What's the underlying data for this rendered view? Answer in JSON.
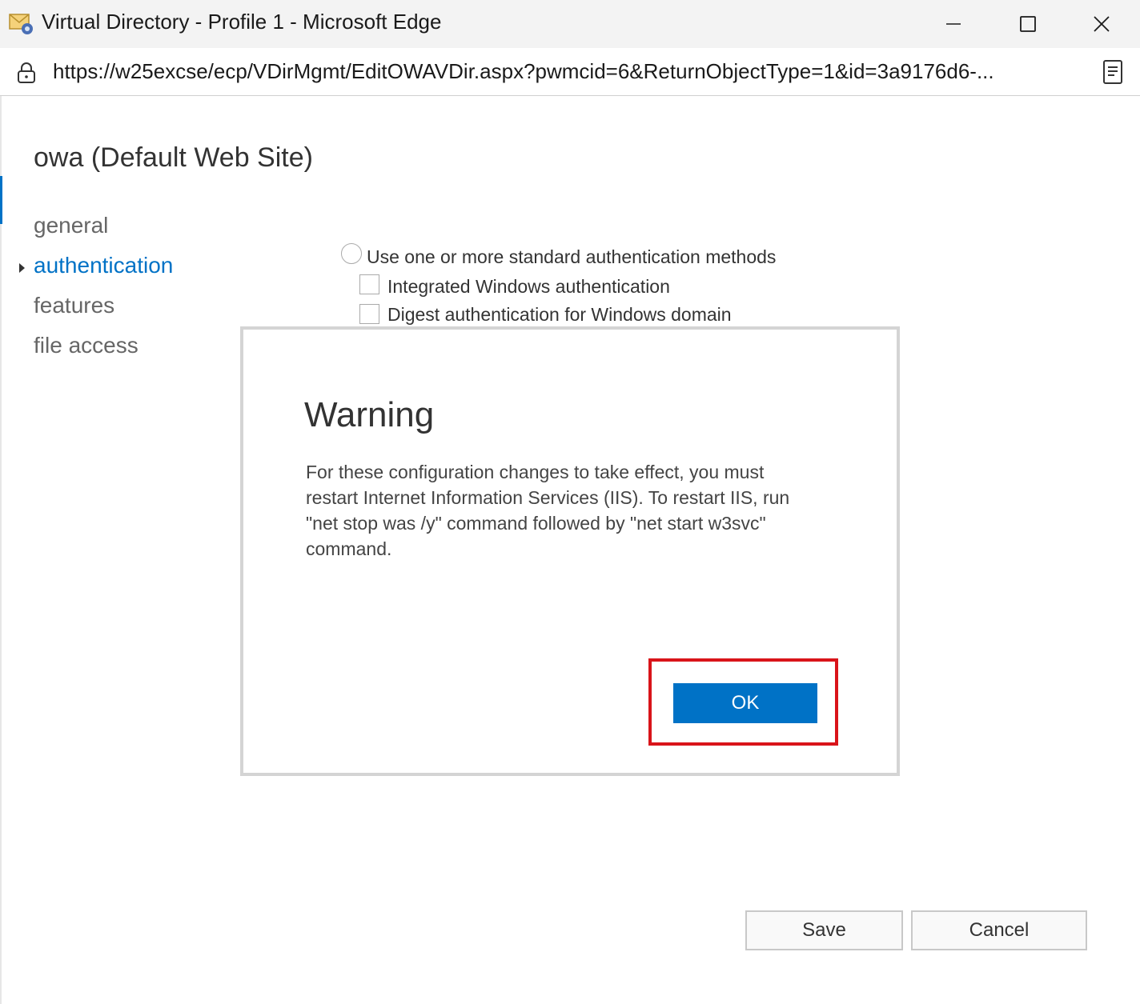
{
  "window": {
    "title": "Virtual Directory - Profile 1 - Microsoft Edge",
    "app_icon": "exchange-mail-icon",
    "controls": [
      "minimize-icon",
      "maximize-icon",
      "close-icon"
    ]
  },
  "addressbar": {
    "url": "https://w25excse/ecp/VDirMgmt/EditOWAVDir.aspx?pwmcid=6&ReturnObjectType=1&id=3a9176d6-...",
    "lock_icon": "lock-icon",
    "reader_icon": "reader-mode-icon"
  },
  "page": {
    "title": "owa (Default Web Site)",
    "nav": [
      {
        "label": "general",
        "active": false
      },
      {
        "label": "authentication",
        "active": true
      },
      {
        "label": "features",
        "active": false
      },
      {
        "label": "file access",
        "active": false
      }
    ],
    "auth": {
      "radio_label": "Use one or more standard authentication methods",
      "options": [
        {
          "label": "Integrated Windows authentication",
          "checked": false
        },
        {
          "label": "Digest authentication for Windows domain",
          "checked": false
        }
      ]
    }
  },
  "dialog": {
    "title": "Warning",
    "message": "For these configuration changes to take effect, you must restart Internet Information Services (IIS). To restart IIS, run \"net stop was /y\" command followed by \"net start w3svc\" command.",
    "ok_label": "OK"
  },
  "footer": {
    "save_label": "Save",
    "cancel_label": "Cancel"
  },
  "colors": {
    "accent": "#0072c6",
    "highlight": "#d9141a"
  }
}
